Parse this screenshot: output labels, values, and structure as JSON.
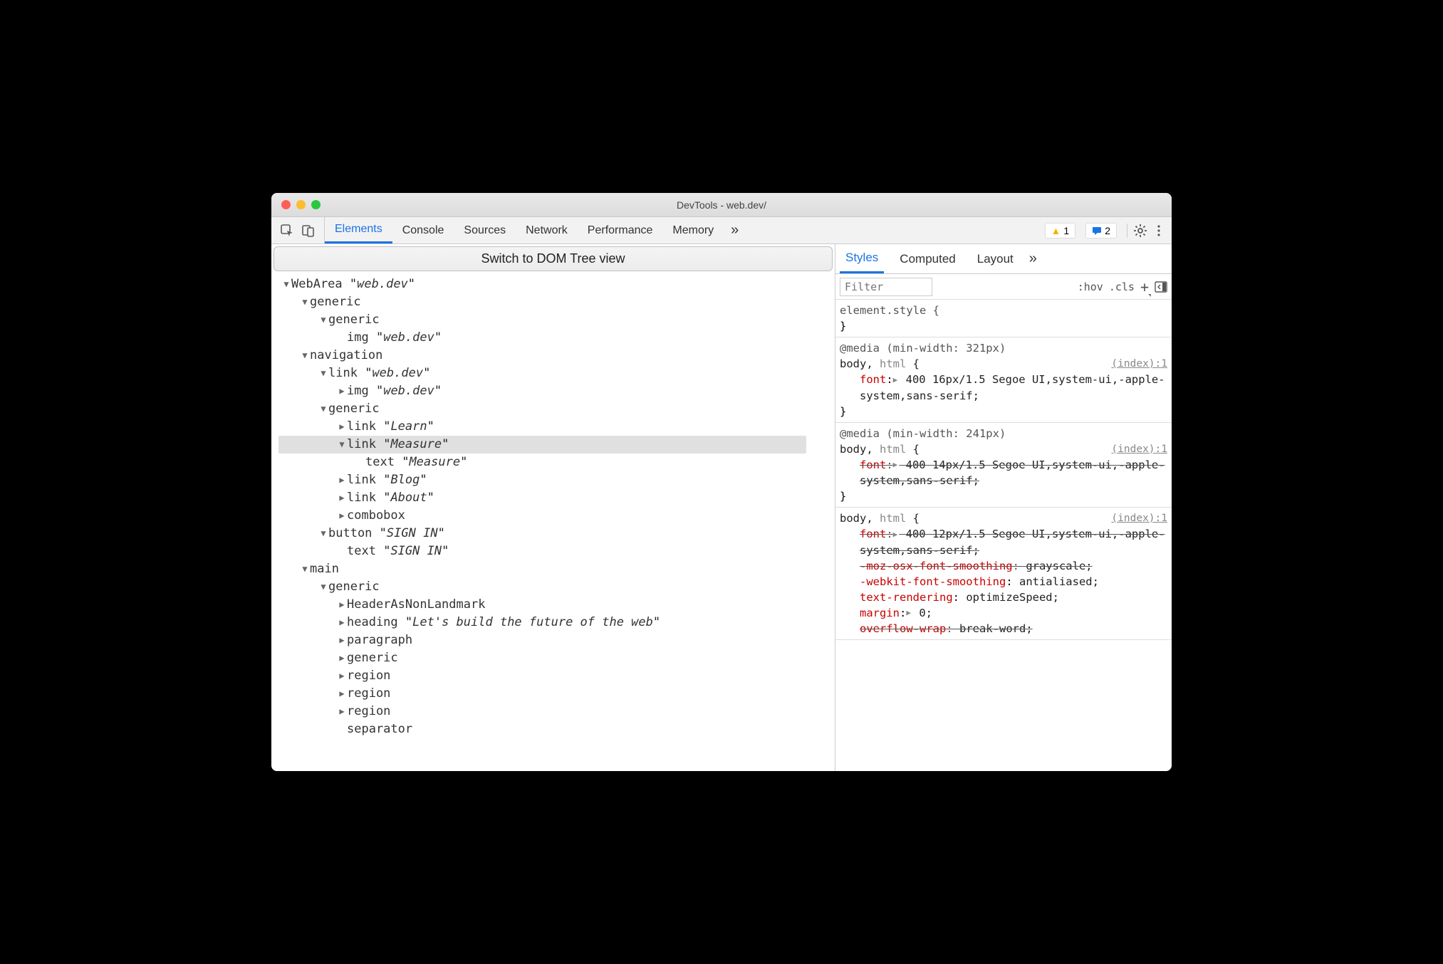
{
  "window": {
    "title": "DevTools - web.dev/"
  },
  "toolbar": {
    "tabs": [
      "Elements",
      "Console",
      "Sources",
      "Network",
      "Performance",
      "Memory"
    ],
    "active": 0,
    "warnings_count": "1",
    "messages_count": "2"
  },
  "leftPanel": {
    "switchButton": "Switch to DOM Tree view",
    "tree": [
      {
        "indent": 0,
        "arrow": "▼",
        "role": "WebArea",
        "name": "web.dev"
      },
      {
        "indent": 1,
        "arrow": "▼",
        "role": "generic"
      },
      {
        "indent": 2,
        "arrow": "▼",
        "role": "generic"
      },
      {
        "indent": 3,
        "arrow": "",
        "role": "img",
        "name": "web.dev"
      },
      {
        "indent": 1,
        "arrow": "▼",
        "role": "navigation"
      },
      {
        "indent": 2,
        "arrow": "▼",
        "role": "link",
        "name": "web.dev"
      },
      {
        "indent": 3,
        "arrow": "▶",
        "role": "img",
        "name": "web.dev"
      },
      {
        "indent": 2,
        "arrow": "▼",
        "role": "generic"
      },
      {
        "indent": 3,
        "arrow": "▶",
        "role": "link",
        "name": "Learn"
      },
      {
        "indent": 3,
        "arrow": "▼",
        "role": "link",
        "name": "Measure",
        "selected": true
      },
      {
        "indent": 4,
        "arrow": "",
        "role": "text",
        "name": "Measure"
      },
      {
        "indent": 3,
        "arrow": "▶",
        "role": "link",
        "name": "Blog"
      },
      {
        "indent": 3,
        "arrow": "▶",
        "role": "link",
        "name": "About"
      },
      {
        "indent": 3,
        "arrow": "▶",
        "role": "combobox"
      },
      {
        "indent": 2,
        "arrow": "▼",
        "role": "button",
        "name": "SIGN IN"
      },
      {
        "indent": 3,
        "arrow": "",
        "role": "text",
        "name": "SIGN IN"
      },
      {
        "indent": 1,
        "arrow": "▼",
        "role": "main"
      },
      {
        "indent": 2,
        "arrow": "▼",
        "role": "generic"
      },
      {
        "indent": 3,
        "arrow": "▶",
        "role": "HeaderAsNonLandmark"
      },
      {
        "indent": 3,
        "arrow": "▶",
        "role": "heading",
        "name": "Let's build the future of the web"
      },
      {
        "indent": 3,
        "arrow": "▶",
        "role": "paragraph"
      },
      {
        "indent": 3,
        "arrow": "▶",
        "role": "generic"
      },
      {
        "indent": 3,
        "arrow": "▶",
        "role": "region"
      },
      {
        "indent": 3,
        "arrow": "▶",
        "role": "region"
      },
      {
        "indent": 3,
        "arrow": "▶",
        "role": "region"
      },
      {
        "indent": 3,
        "arrow": "",
        "role": "separator"
      }
    ]
  },
  "rightPanel": {
    "tabs": [
      "Styles",
      "Computed",
      "Layout"
    ],
    "active": 0,
    "filterPlaceholder": "Filter",
    "hov": ":hov",
    "cls": ".cls",
    "styles": {
      "elementStyle": {
        "label": "element.style {",
        "close": "}"
      },
      "rules": [
        {
          "media": "@media (min-width: 321px)",
          "selectorDark": "body,",
          "selectorLight": " html",
          "open": " {",
          "source": "(index):1",
          "decls": [
            {
              "prop": "font",
              "pre": "▶ ",
              "val": "400 16px/1.5 Segoe UI,system-ui,-apple-system,sans-serif;",
              "struck": false
            }
          ],
          "close": "}"
        },
        {
          "media": "@media (min-width: 241px)",
          "selectorDark": "body,",
          "selectorLight": " html",
          "open": " {",
          "source": "(index):1",
          "decls": [
            {
              "prop": "font",
              "pre": "▶ ",
              "val": "400 14px/1.5 Segoe UI,system-ui,-apple-system,sans-serif;",
              "struck": true
            }
          ],
          "close": "}"
        },
        {
          "media": "",
          "selectorDark": "body,",
          "selectorLight": " html",
          "open": " {",
          "source": "(index):1",
          "decls": [
            {
              "prop": "font",
              "pre": "▶ ",
              "val": "400 12px/1.5 Segoe UI,system-ui,-apple-system,sans-serif;",
              "struck": true
            },
            {
              "prop": "-moz-osx-font-smoothing",
              "pre": "",
              "val": "grayscale;",
              "struck": true
            },
            {
              "prop": "-webkit-font-smoothing",
              "pre": "",
              "val": "antialiased;",
              "struck": false
            },
            {
              "prop": "text-rendering",
              "pre": "",
              "val": "optimizeSpeed;",
              "struck": false
            },
            {
              "prop": "margin",
              "pre": "▶ ",
              "val": "0;",
              "struck": false
            },
            {
              "prop": "overflow-wrap",
              "pre": "",
              "val": "break-word;",
              "struck": true,
              "cutoff": true
            }
          ],
          "close": ""
        }
      ]
    }
  }
}
